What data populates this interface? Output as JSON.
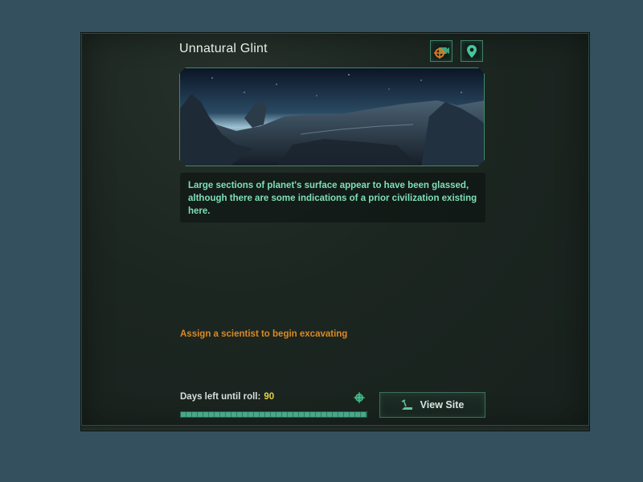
{
  "event": {
    "title": "Unnatural Glint",
    "description": "Large sections of planet's surface appear to have been glassed, although there are some indications of a prior civilization existing here.",
    "status": "Assign a scientist to begin excavating"
  },
  "header_buttons": {
    "camera_icon": "camera-target-icon",
    "location_icon": "location-pin-icon"
  },
  "roll": {
    "label": "Days left until roll:",
    "days": "90",
    "progress": 1.0
  },
  "actions": {
    "view_site_label": "View Site",
    "view_site_icon": "excavation-icon"
  },
  "colors": {
    "accent": "#3e8a6c",
    "description_text": "#7fe0b9",
    "status_text": "#d98a24",
    "days_value": "#e4d24a"
  }
}
